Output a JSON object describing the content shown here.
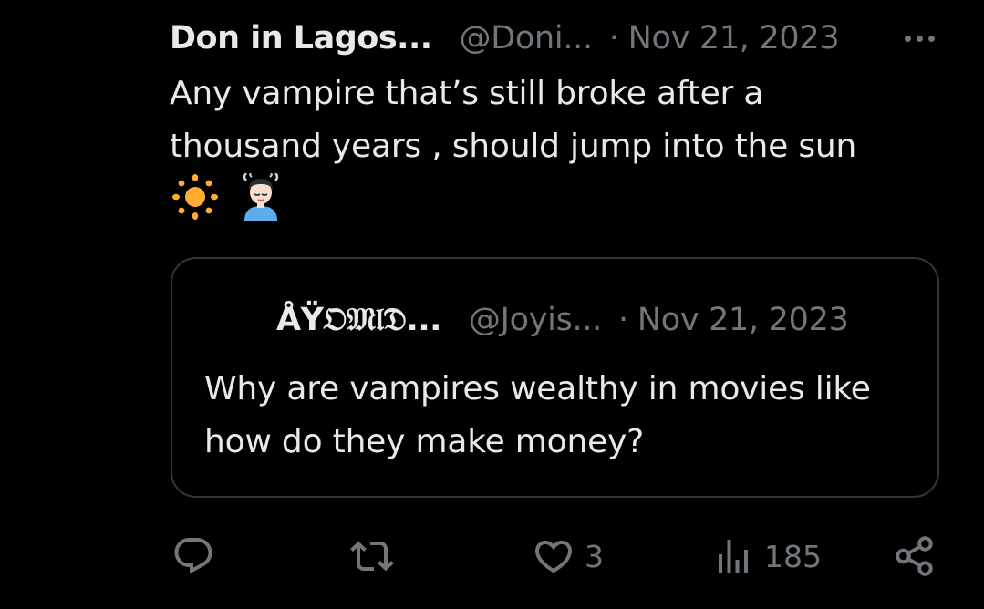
{
  "post": {
    "author_name": "Don in Lagos...",
    "handle": "@Doni...",
    "separator": "·",
    "date": "Nov 21, 2023",
    "text_line1": "Any vampire that’s still broke after a",
    "text_line2": "thousand years , should jump into the sun",
    "emojis": [
      "sun-emoji",
      "person-in-steamy-room-emoji"
    ]
  },
  "quoted_post": {
    "author_name": "ÅŸ𝔒𝔐𝔩𝔇...",
    "handle": "@Joyis...",
    "separator": "·",
    "date": "Nov 21, 2023",
    "text_line1": "Why are vampires wealthy in movies like",
    "text_line2": "how do they make money?"
  },
  "actions": {
    "reply_count": "",
    "repost_count": "",
    "like_count": "3",
    "views_count": "185"
  },
  "colors": {
    "background": "#000000",
    "text": "#e7e9ea",
    "muted": "#71767b",
    "border": "#333639"
  },
  "icons": {
    "more": "more-dots-icon",
    "reply": "reply-icon",
    "repost": "repost-icon",
    "like": "heart-icon",
    "views": "views-icon",
    "share": "share-icon"
  }
}
